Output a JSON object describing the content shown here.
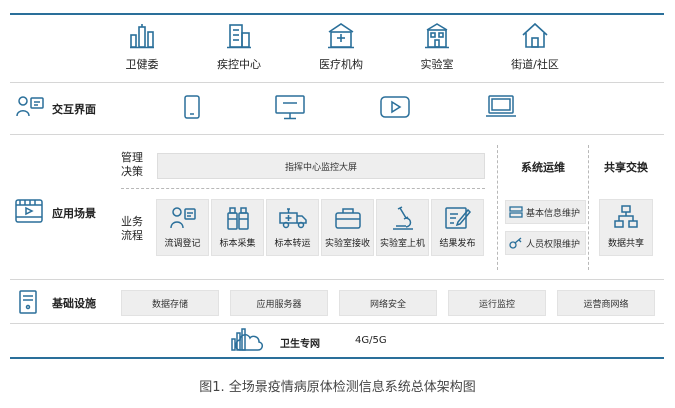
{
  "top_orgs": [
    {
      "icon": "health-commission-icon",
      "label": "卫健委"
    },
    {
      "icon": "cdc-building-icon",
      "label": "疾控中心"
    },
    {
      "icon": "hospital-icon",
      "label": "医疗机构"
    },
    {
      "icon": "laboratory-building-icon",
      "label": "实验室"
    },
    {
      "icon": "community-house-icon",
      "label": "街道/社区"
    }
  ],
  "interaction": {
    "label": "交互界面",
    "devices": [
      "mobile-phone-icon",
      "monitor-icon",
      "video-player-icon",
      "laptop-icon"
    ]
  },
  "application": {
    "label": "应用场景",
    "management_label": "管理\n决策",
    "management_banner": "指挥中心监控大屏",
    "business_label": "业务\n流程",
    "flow": [
      {
        "icon": "survey-person-icon",
        "label": "流调登记"
      },
      {
        "icon": "sample-bottles-icon",
        "label": "标本采集"
      },
      {
        "icon": "ambulance-icon",
        "label": "标本转运"
      },
      {
        "icon": "sample-box-icon",
        "label": "实验室接收"
      },
      {
        "icon": "microscope-icon",
        "label": "实验室上机"
      },
      {
        "icon": "report-pen-icon",
        "label": "结果发布"
      }
    ],
    "ops_title": "系统运维",
    "ops_items": [
      {
        "icon": "server-list-icon",
        "label": "基本信息维护"
      },
      {
        "icon": "key-icon",
        "label": "人员权限维护"
      }
    ],
    "share_title": "共享交换",
    "share_item": {
      "icon": "network-tree-icon",
      "label": "数据共享"
    }
  },
  "infrastructure": {
    "label": "基础设施",
    "items": [
      "数据存储",
      "应用服务器",
      "网络安全",
      "运行监控",
      "运营商网络"
    ]
  },
  "network": {
    "label": "卫生专网",
    "label2": "4G/5G"
  },
  "caption": "图1. 全场景疫情病原体检测信息系统总体架构图",
  "colors": {
    "accent": "#2a6f9a",
    "line": "#d6d6d6",
    "panel": "#eeeeee"
  }
}
